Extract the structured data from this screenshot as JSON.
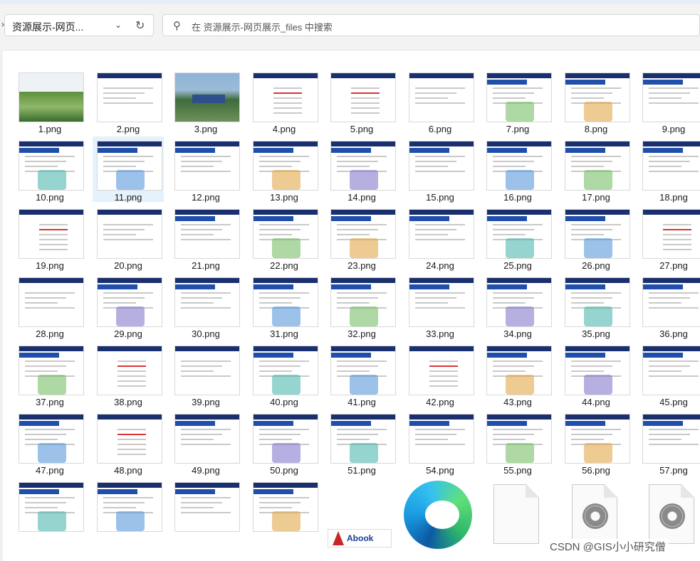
{
  "toolbar": {
    "address_label": "资源展示-网页...",
    "search_placeholder": "在 资源展示-网页展示_files 中搜索"
  },
  "files": [
    {
      "name": "1.png",
      "kind": "cover"
    },
    {
      "name": "2.png",
      "kind": "text"
    },
    {
      "name": "3.png",
      "kind": "landscape"
    },
    {
      "name": "4.png",
      "kind": "toc"
    },
    {
      "name": "5.png",
      "kind": "toc"
    },
    {
      "name": "6.png",
      "kind": "list"
    },
    {
      "name": "7.png",
      "kind": "slide"
    },
    {
      "name": "8.png",
      "kind": "slide"
    },
    {
      "name": "9.png",
      "kind": "slide"
    },
    {
      "name": "10.png",
      "kind": "slide"
    },
    {
      "name": "11.png",
      "kind": "slide",
      "selected": true
    },
    {
      "name": "12.png",
      "kind": "slide"
    },
    {
      "name": "13.png",
      "kind": "slide"
    },
    {
      "name": "14.png",
      "kind": "slide"
    },
    {
      "name": "15.png",
      "kind": "slide"
    },
    {
      "name": "16.png",
      "kind": "slide"
    },
    {
      "name": "17.png",
      "kind": "slide"
    },
    {
      "name": "18.png",
      "kind": "slide"
    },
    {
      "name": "19.png",
      "kind": "toc"
    },
    {
      "name": "20.png",
      "kind": "list"
    },
    {
      "name": "21.png",
      "kind": "slide"
    },
    {
      "name": "22.png",
      "kind": "slide"
    },
    {
      "name": "23.png",
      "kind": "slide"
    },
    {
      "name": "24.png",
      "kind": "slide"
    },
    {
      "name": "25.png",
      "kind": "slide"
    },
    {
      "name": "26.png",
      "kind": "slide"
    },
    {
      "name": "27.png",
      "kind": "toc"
    },
    {
      "name": "28.png",
      "kind": "list"
    },
    {
      "name": "29.png",
      "kind": "slide"
    },
    {
      "name": "30.png",
      "kind": "slide"
    },
    {
      "name": "31.png",
      "kind": "slide"
    },
    {
      "name": "32.png",
      "kind": "slide"
    },
    {
      "name": "33.png",
      "kind": "slide"
    },
    {
      "name": "34.png",
      "kind": "slide"
    },
    {
      "name": "35.png",
      "kind": "slide"
    },
    {
      "name": "36.png",
      "kind": "slide"
    },
    {
      "name": "37.png",
      "kind": "slide"
    },
    {
      "name": "38.png",
      "kind": "toc"
    },
    {
      "name": "39.png",
      "kind": "list"
    },
    {
      "name": "40.png",
      "kind": "slide"
    },
    {
      "name": "41.png",
      "kind": "slide"
    },
    {
      "name": "42.png",
      "kind": "toc"
    },
    {
      "name": "43.png",
      "kind": "slide"
    },
    {
      "name": "44.png",
      "kind": "slide"
    },
    {
      "name": "45.png",
      "kind": "slide"
    },
    {
      "name": "47.png",
      "kind": "slide"
    },
    {
      "name": "48.png",
      "kind": "toc"
    },
    {
      "name": "49.png",
      "kind": "slide"
    },
    {
      "name": "50.png",
      "kind": "slide"
    },
    {
      "name": "51.png",
      "kind": "slide"
    },
    {
      "name": "54.png",
      "kind": "slide"
    },
    {
      "name": "55.png",
      "kind": "slide"
    },
    {
      "name": "56.png",
      "kind": "slide"
    },
    {
      "name": "57.png",
      "kind": "slide"
    },
    {
      "name": "",
      "kind": "slide"
    },
    {
      "name": "",
      "kind": "slide"
    },
    {
      "name": "",
      "kind": "slide"
    },
    {
      "name": "",
      "kind": "slide"
    }
  ],
  "abook_text": "Abook",
  "watermark": "CSDN @GIS小小研究僧",
  "colors": {
    "slide_header": "#1a2f6e",
    "slide_subheader": "#1f4faa",
    "selection": "#e5f1fb"
  }
}
